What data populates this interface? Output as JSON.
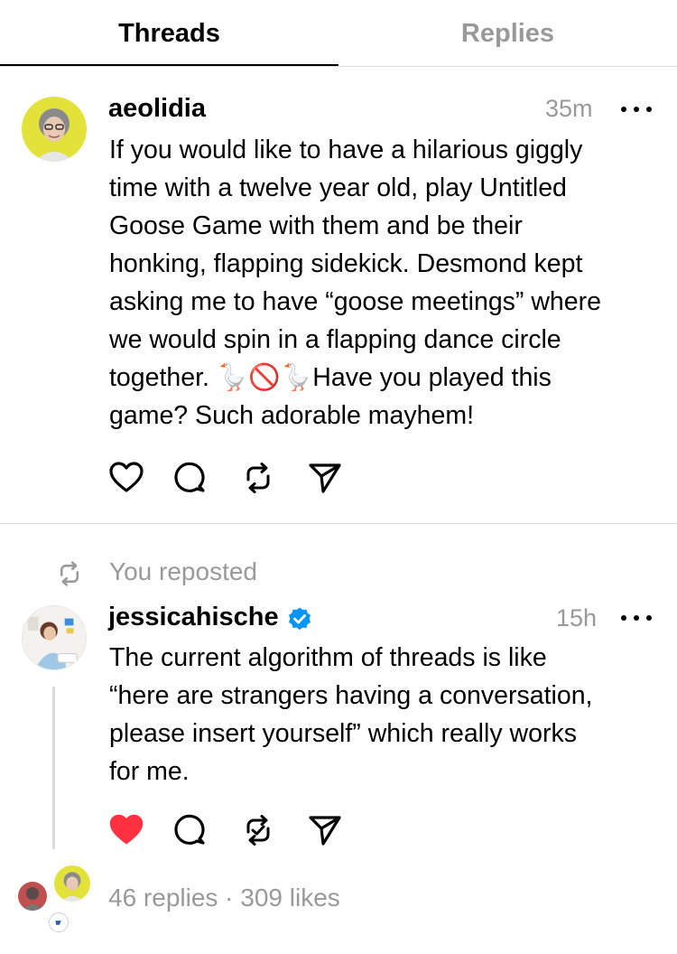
{
  "tabs": {
    "threads": "Threads",
    "replies": "Replies"
  },
  "post1": {
    "username": "aeolidia",
    "time": "35m",
    "text": "If you would like to have a hilarious giggly\ntime with a twelve year old, play Untitled\nGoose Game with them and be their\nhonking, flapping sidekick. Desmond kept\nasking me to have “goose meetings” where\nwe would spin in a flapping dance circle\ntogether. 🪿🚫🪿Have you played this\ngame? Such adorable mayhem!",
    "liked": false
  },
  "repost_label": "You reposted",
  "post2": {
    "username": "jessicahische",
    "verified": true,
    "time": "15h",
    "text": "The current algorithm of threads is like\n“here are strangers having a conversation,\nplease insert yourself” which really works\nfor me.",
    "liked": true,
    "stats": "46 replies · 309 likes"
  },
  "icons": {
    "like": "heart-icon",
    "comment": "comment-icon",
    "repost": "repost-icon",
    "share": "send-icon",
    "more": "more-icon",
    "verified": "verified-badge-icon"
  },
  "colors": {
    "like_red": "#ff3040",
    "verified_blue": "#0095f6",
    "muted_gray": "#999999",
    "divider": "#dbdbdb"
  }
}
